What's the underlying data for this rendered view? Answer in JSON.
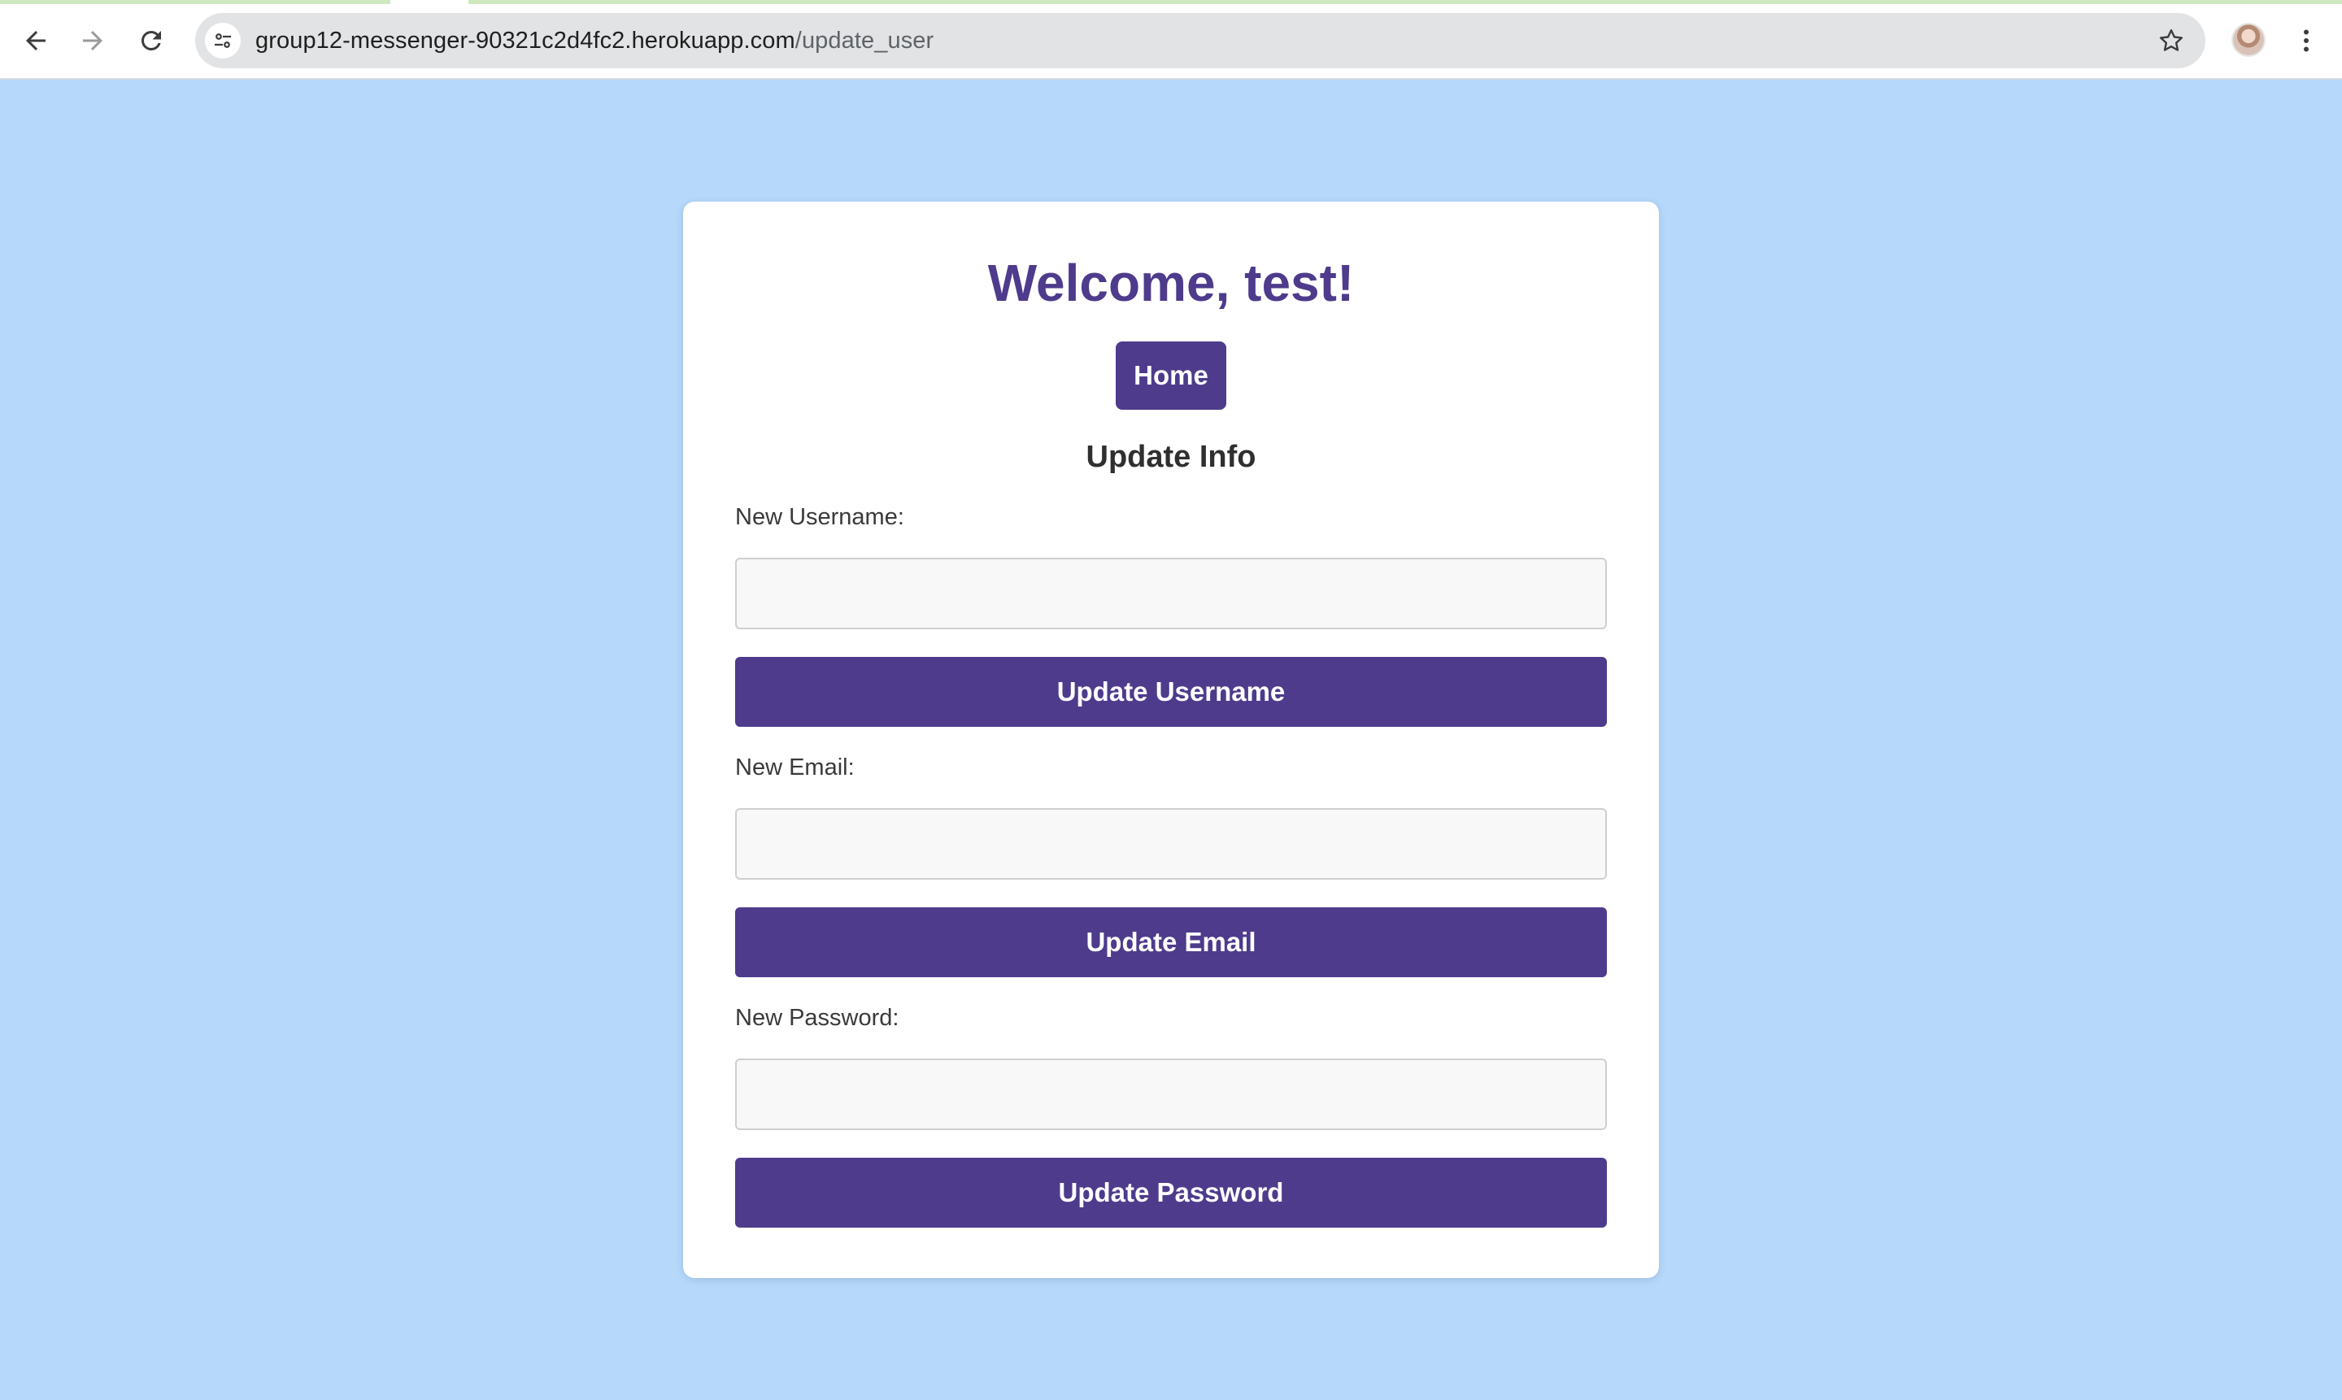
{
  "browser": {
    "url_host": "group12-messenger-90321c2d4fc2.herokuapp.com",
    "url_path": "/update_user",
    "icons": {
      "back": "arrow-left-icon",
      "forward": "arrow-right-icon",
      "reload": "reload-icon",
      "site_info": "tune-icon",
      "bookmark": "star-icon",
      "profile": "avatar",
      "menu": "kebab-menu-icon"
    }
  },
  "page": {
    "welcome": "Welcome, test!",
    "home_button": "Home",
    "section_title": "Update Info",
    "username": {
      "label": "New Username:",
      "value": "",
      "button": "Update Username"
    },
    "email": {
      "label": "New Email:",
      "value": "",
      "button": "Update Email"
    },
    "password": {
      "label": "New Password:",
      "value": "",
      "button": "Update Password"
    }
  },
  "colors": {
    "page_background": "#b5d8fb",
    "accent": "#4e3b8c",
    "card": "#ffffff"
  }
}
